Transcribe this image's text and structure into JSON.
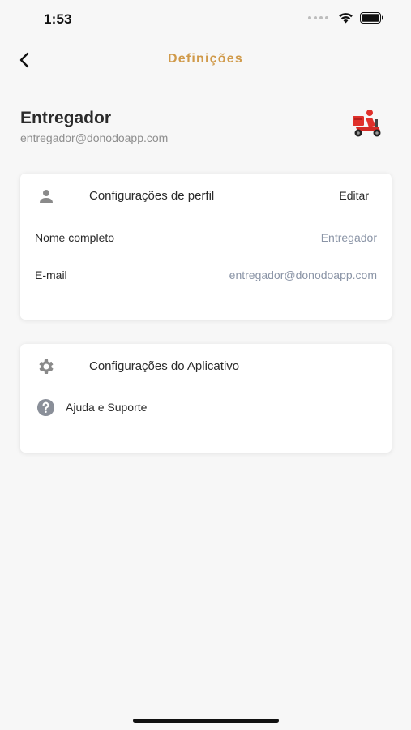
{
  "status_bar": {
    "time": "1:53"
  },
  "header": {
    "title": "Definições",
    "back_icon": "chevron-left-icon"
  },
  "profile": {
    "name": "Entregador",
    "email": "entregador@donodoapp.com",
    "avatar_icon": "delivery-scooter-icon"
  },
  "profile_settings": {
    "title": "Configurações de perfil",
    "icon": "person-icon",
    "edit_label": "Editar",
    "fields": [
      {
        "label": "Nome completo",
        "value": "Entregador"
      },
      {
        "label": "E-mail",
        "value": "entregador@donodoapp.com"
      }
    ]
  },
  "app_settings": {
    "title": "Configurações do Aplicativo",
    "icon": "gear-icon",
    "items": [
      {
        "label": "Ajuda e Suporte",
        "icon": "help-circle-icon"
      }
    ]
  },
  "colors": {
    "accent": "#d09a4a",
    "background": "#f7f7f7",
    "card": "#ffffff",
    "muted_value": "#8a94a6"
  }
}
